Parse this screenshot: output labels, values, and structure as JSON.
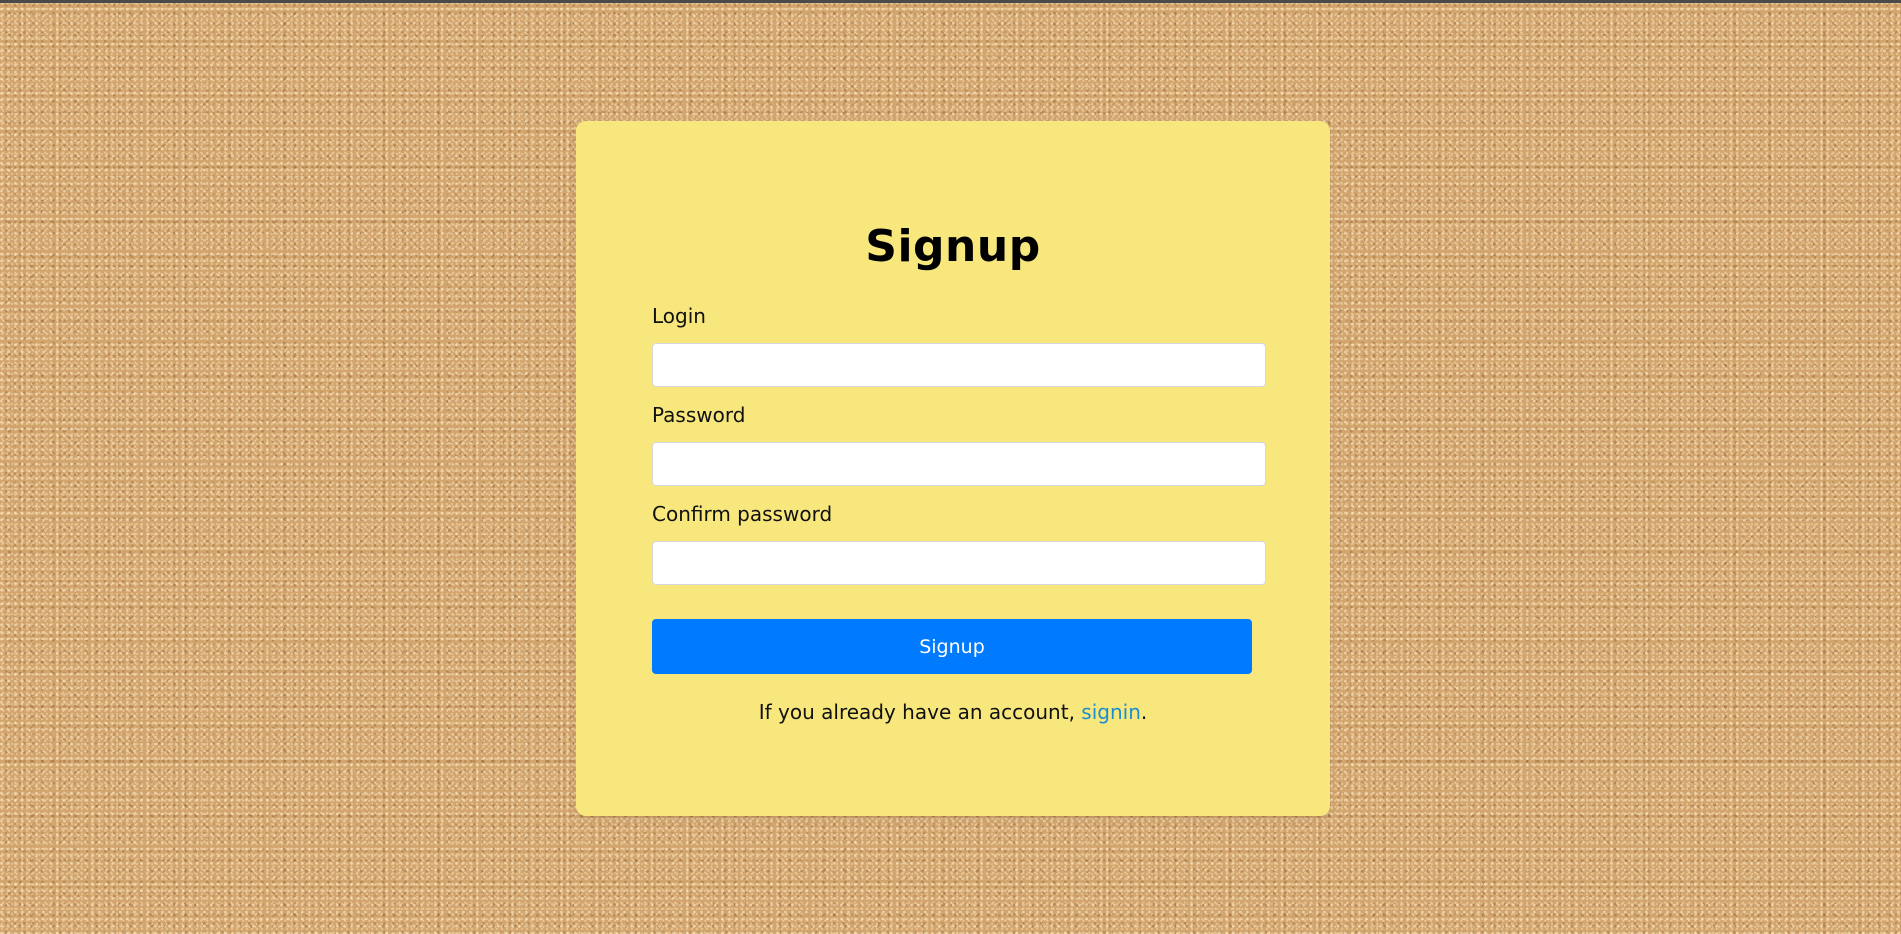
{
  "form": {
    "title": "Signup",
    "fields": [
      {
        "label": "Login",
        "value": "",
        "placeholder": ""
      },
      {
        "label": "Password",
        "value": "",
        "placeholder": ""
      },
      {
        "label": "Confirm password",
        "value": "",
        "placeholder": ""
      }
    ],
    "submit_label": "Signup",
    "footer_prefix": "If you already have an account, ",
    "footer_link": "signin",
    "footer_suffix": "."
  },
  "colors": {
    "card_background": "#f7e77d",
    "button_background": "#007bff",
    "link": "#1a8fd0",
    "page_background": "#d3a56e"
  }
}
